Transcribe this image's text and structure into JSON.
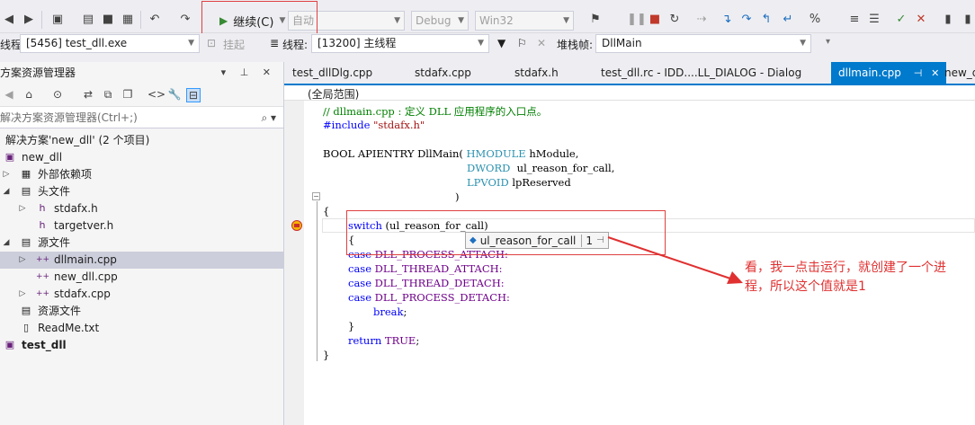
{
  "toolbar": {
    "continue_label": "继续(C)",
    "auto_label": "自动",
    "config_combo": "Debug",
    "platform_combo": "Win32"
  },
  "debugbar": {
    "process_label": "线程:",
    "process_value": "[5456] test_dll.exe",
    "suspend_label": "挂起",
    "thread_label": "线程:",
    "thread_value": "[13200] 主线程",
    "stackframe_label": "堆栈帧:",
    "stackframe_value": "DllMain"
  },
  "solution_explorer": {
    "title": "方案资源管理器",
    "search_placeholder": "解决方案资源管理器(Ctrl+;)",
    "items": [
      {
        "label": "解决方案'new_dll' (2 个项目)"
      },
      {
        "label": "new_dll"
      },
      {
        "label": "外部依赖项"
      },
      {
        "label": "头文件"
      },
      {
        "label": "stdafx.h"
      },
      {
        "label": "targetver.h"
      },
      {
        "label": "源文件"
      },
      {
        "label": "dllmain.cpp"
      },
      {
        "label": "new_dll.cpp"
      },
      {
        "label": "stdafx.cpp"
      },
      {
        "label": "资源文件"
      },
      {
        "label": "ReadMe.txt"
      },
      {
        "label": "test_dll"
      }
    ]
  },
  "tabs": [
    {
      "label": "test_dllDlg.cpp"
    },
    {
      "label": "stdafx.cpp"
    },
    {
      "label": "stdafx.h"
    },
    {
      "label": "test_dll.rc - IDD....LL_DIALOG - Dialog"
    },
    {
      "label": "dllmain.cpp"
    },
    {
      "label": "new_d"
    }
  ],
  "scope": "(全局范围)",
  "code": {
    "l1": "// dllmain.cpp : 定义 DLL 应用程序的入口点。",
    "l2_kw": "#include",
    "l2_str": " \"stdafx.h\"",
    "l3_a": "BOOL APIENTRY DllMain( ",
    "l3_ty": "HMODULE",
    "l3_b": " hModule,",
    "l4_ty": "DWORD",
    "l4_b": "  ul_reason_for_call,",
    "l5_ty": "LPVOID",
    "l5_b": " lpReserved",
    "l6": ")",
    "l7": "{",
    "l8_kw": "switch",
    "l8_b": " (ul_reason_for_call)",
    "l9": "{",
    "l10_kw": "case",
    "l10_mc": " DLL_PROCESS_ATTACH:",
    "l11_kw": "case",
    "l11_mc": " DLL_THREAD_ATTACH:",
    "l12_kw": "case",
    "l12_mc": " DLL_THREAD_DETACH:",
    "l13_kw": "case",
    "l13_mc": " DLL_PROCESS_DETACH:",
    "l14_kw": "break",
    "l14_b": ";",
    "l15": "}",
    "l16_kw": "return",
    "l16_mc": " TRUE",
    "l16_b": ";",
    "l17": "}"
  },
  "datatip": {
    "name": "ul_reason_for_call",
    "value": "1"
  },
  "annotation": "看，我一点击运行，就创建了一个进程，所以这个值就是1",
  "colors": {
    "accent": "#007acc",
    "annotation_red": "#e03030"
  }
}
